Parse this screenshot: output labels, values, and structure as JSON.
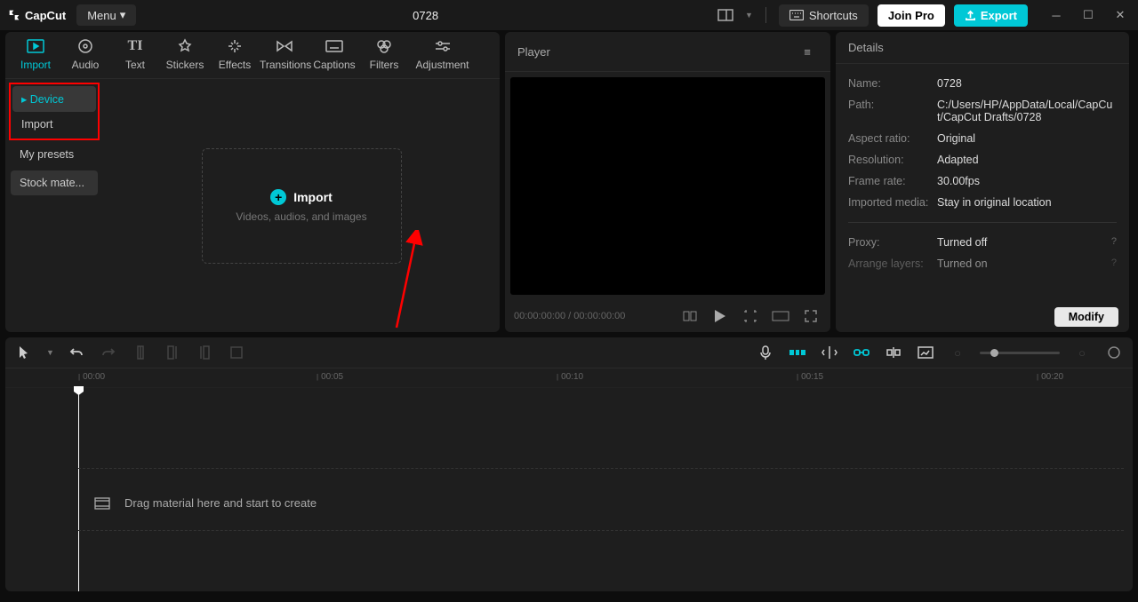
{
  "app": {
    "name": "CapCut",
    "menu": "Menu",
    "title": "0728"
  },
  "titlebar": {
    "shortcuts": "Shortcuts",
    "joinpro": "Join Pro",
    "export": "Export"
  },
  "tabs": [
    "Import",
    "Audio",
    "Text",
    "Stickers",
    "Effects",
    "Transitions",
    "Captions",
    "Filters",
    "Adjustment"
  ],
  "sources": {
    "device": "Device",
    "import": "Import",
    "presets": "My presets",
    "stock": "Stock mate..."
  },
  "importBox": {
    "label": "Import",
    "sub": "Videos, audios, and images"
  },
  "player": {
    "title": "Player",
    "time": "00:00:00:00 / 00:00:00:00"
  },
  "details": {
    "title": "Details",
    "name_l": "Name:",
    "name_v": "0728",
    "path_l": "Path:",
    "path_v": "C:/Users/HP/AppData/Local/CapCut/CapCut Drafts/0728",
    "ratio_l": "Aspect ratio:",
    "ratio_v": "Original",
    "res_l": "Resolution:",
    "res_v": "Adapted",
    "fps_l": "Frame rate:",
    "fps_v": "30.00fps",
    "media_l": "Imported media:",
    "media_v": "Stay in original location",
    "proxy_l": "Proxy:",
    "proxy_v": "Turned off",
    "arrange_l": "Arrange layers:",
    "arrange_v": "Turned on",
    "modify": "Modify"
  },
  "timeline": {
    "ticks": [
      "00:00",
      "00:05",
      "00:10",
      "00:15",
      "00:20"
    ],
    "hint": "Drag material here and start to create"
  }
}
